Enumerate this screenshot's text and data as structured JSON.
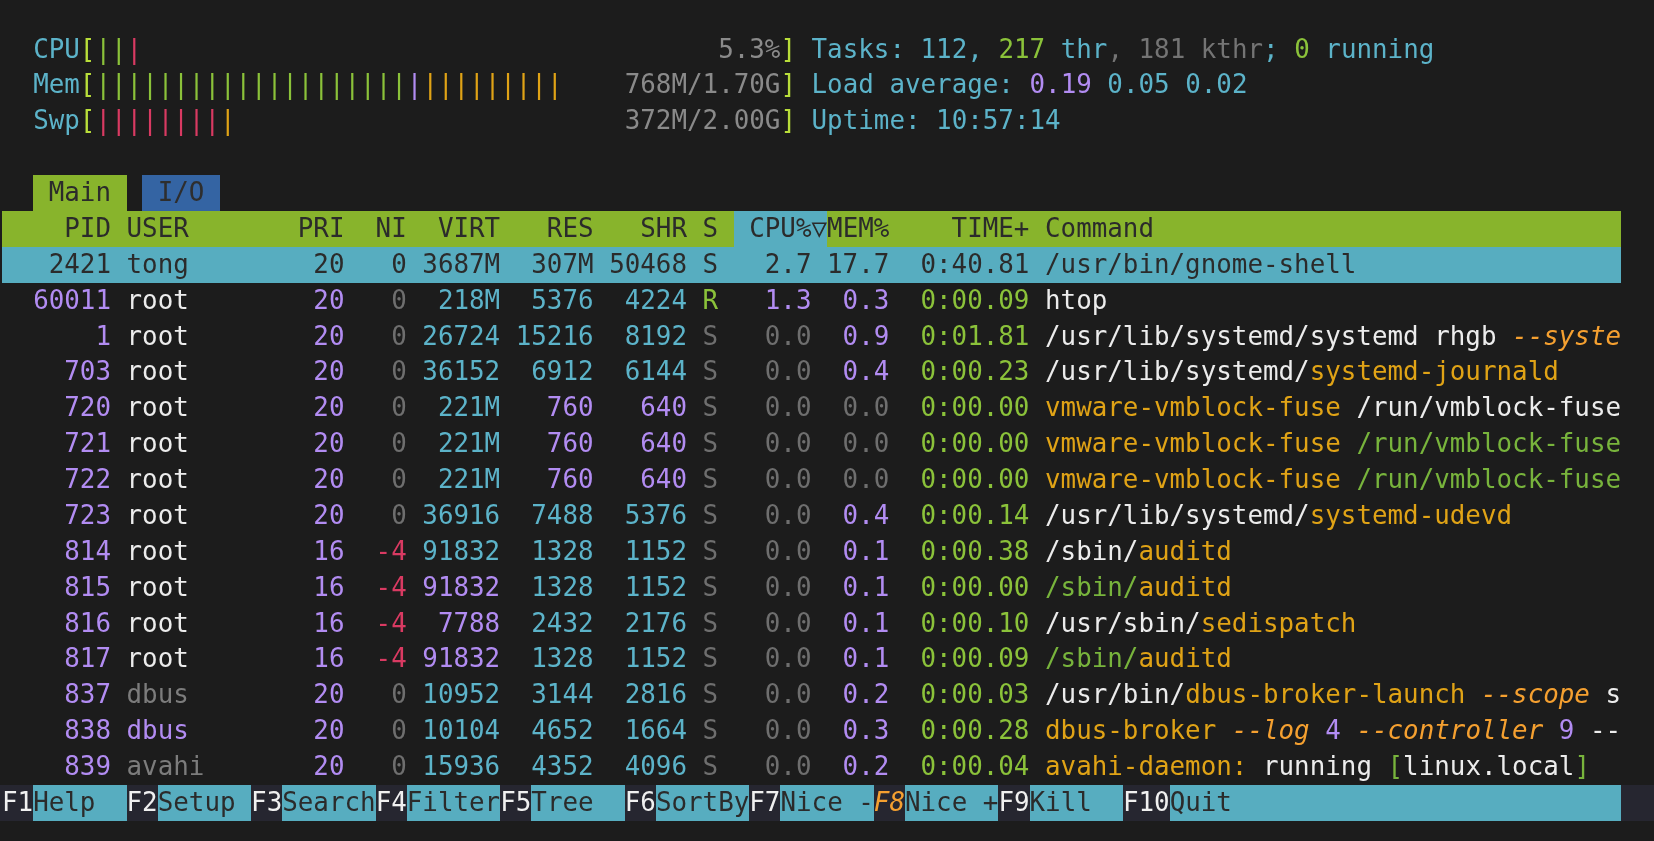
{
  "meters": [
    {
      "label": "CPU",
      "open": "[",
      "bars": [
        {
          "text": "||",
          "color": "#8bc23a"
        },
        {
          "text": "|",
          "color": "#d93a62"
        }
      ],
      "reading": "5.3%",
      "close": "]"
    },
    {
      "label": "Mem",
      "open": "[",
      "bars": [
        {
          "text": "||||||||||||||||||||",
          "color": "#8bc23a"
        },
        {
          "text": "|",
          "color": "#b28cf2"
        },
        {
          "text": "|||||||||",
          "color": "#e0a316"
        }
      ],
      "reading": "768M/1.70G",
      "close": "]"
    },
    {
      "label": "Swp",
      "open": "[",
      "bars": [
        {
          "text": "||||||||",
          "color": "#d93a62"
        },
        {
          "text": "|",
          "color": "#e0a316"
        }
      ],
      "reading": "372M/2.00G",
      "close": "]"
    }
  ],
  "summary": [
    [
      {
        "text": "Tasks: 112, ",
        "color": "#5cb3c9"
      },
      {
        "text": "217",
        "color": "#8bc23a"
      },
      {
        "text": " thr",
        "color": "#5cb3c9"
      },
      {
        "text": ", 181 kthr",
        "color": "#747474"
      },
      {
        "text": "; ",
        "color": "#5cb3c9"
      },
      {
        "text": "0",
        "color": "#8bc23a"
      },
      {
        "text": " running",
        "color": "#5cb3c9"
      }
    ],
    [
      {
        "text": "Load average: ",
        "color": "#5cb3c9"
      },
      {
        "text": "0.19",
        "color": "#b28cf2"
      },
      {
        "text": " 0.05 0.02",
        "color": "#5cb3c9"
      }
    ],
    [
      {
        "text": "Uptime: 10:57:14",
        "color": "#5cb3c9"
      }
    ]
  ],
  "tabs": [
    {
      "label": "Main",
      "selected": true
    },
    {
      "label": "I/O",
      "selected": false
    }
  ],
  "columns": [
    {
      "label": "PID",
      "selected": false
    },
    {
      "label": "USER",
      "selected": false
    },
    {
      "label": "PRI",
      "selected": false
    },
    {
      "label": "NI",
      "selected": false
    },
    {
      "label": "VIRT",
      "selected": false
    },
    {
      "label": "RES",
      "selected": false
    },
    {
      "label": "SHR",
      "selected": false
    },
    {
      "label": "S",
      "selected": false
    },
    {
      "label": "CPU%▽",
      "selected": true
    },
    {
      "label": "MEM%",
      "selected": false
    },
    {
      "label": "TIME+",
      "selected": false
    },
    {
      "label": "Command",
      "selected": false
    }
  ],
  "rows": [
    {
      "selected": true,
      "cells": [
        {
          "text": "2421"
        },
        {
          "text": "tong"
        },
        {
          "text": "20"
        },
        {
          "text": "0"
        },
        {
          "text": "3687M"
        },
        {
          "text": "307M"
        },
        {
          "text": "50468"
        },
        {
          "text": "S"
        },
        {
          "text": "2.7"
        },
        {
          "text": "17.7"
        },
        {
          "text": "0:40.81"
        }
      ],
      "command": [
        {
          "text": "/usr/bin/gnome-shell"
        }
      ]
    },
    {
      "selected": false,
      "cells": [
        {
          "text": "60011",
          "color": "#b28cf2"
        },
        {
          "text": "root",
          "color": "#ececec"
        },
        {
          "text": "20",
          "color": "#b28cf2"
        },
        {
          "text": "0",
          "color": "#6e6e6e"
        },
        {
          "text": "218M",
          "color": "#5cb3c9"
        },
        {
          "text": "5376",
          "color": "#5cb3c9"
        },
        {
          "text": "4224",
          "color": "#5cb3c9"
        },
        {
          "text": "R",
          "color": "#8bc23a"
        },
        {
          "text": "1.3",
          "color": "#b28cf2"
        },
        {
          "text": "0.3",
          "color": "#b28cf2"
        },
        {
          "text": "0:00.09",
          "color": "#8bc23a"
        }
      ],
      "command": [
        {
          "text": "htop",
          "color": "#ececec"
        }
      ]
    },
    {
      "selected": false,
      "cells": [
        {
          "text": "1",
          "color": "#b28cf2"
        },
        {
          "text": "root",
          "color": "#ececec"
        },
        {
          "text": "20",
          "color": "#b28cf2"
        },
        {
          "text": "0",
          "color": "#6e6e6e"
        },
        {
          "text": "26724",
          "color": "#5cb3c9"
        },
        {
          "text": "15216",
          "color": "#5cb3c9"
        },
        {
          "text": "8192",
          "color": "#5cb3c9"
        },
        {
          "text": "S",
          "color": "#6e6e6e"
        },
        {
          "text": "0.0",
          "color": "#6e6e6e"
        },
        {
          "text": "0.9",
          "color": "#b28cf2"
        },
        {
          "text": "0:01.81",
          "color": "#8bc23a"
        }
      ],
      "command": [
        {
          "text": "/usr/lib/systemd/systemd rhgb ",
          "color": "#ececec"
        },
        {
          "text": "--syste",
          "color": "#f5a030",
          "italic": true
        }
      ]
    },
    {
      "selected": false,
      "cells": [
        {
          "text": "703",
          "color": "#b28cf2"
        },
        {
          "text": "root",
          "color": "#ececec"
        },
        {
          "text": "20",
          "color": "#b28cf2"
        },
        {
          "text": "0",
          "color": "#6e6e6e"
        },
        {
          "text": "36152",
          "color": "#5cb3c9"
        },
        {
          "text": "6912",
          "color": "#5cb3c9"
        },
        {
          "text": "6144",
          "color": "#5cb3c9"
        },
        {
          "text": "S",
          "color": "#6e6e6e"
        },
        {
          "text": "0.0",
          "color": "#6e6e6e"
        },
        {
          "text": "0.4",
          "color": "#b28cf2"
        },
        {
          "text": "0:00.23",
          "color": "#8bc23a"
        }
      ],
      "command": [
        {
          "text": "/usr/lib/systemd/",
          "color": "#ececec"
        },
        {
          "text": "systemd-journald",
          "color": "#e0a316"
        }
      ]
    },
    {
      "selected": false,
      "cells": [
        {
          "text": "720",
          "color": "#b28cf2"
        },
        {
          "text": "root",
          "color": "#ececec"
        },
        {
          "text": "20",
          "color": "#b28cf2"
        },
        {
          "text": "0",
          "color": "#6e6e6e"
        },
        {
          "text": "221M",
          "color": "#5cb3c9"
        },
        {
          "text": "760",
          "color": "#b28cf2"
        },
        {
          "text": "640",
          "color": "#b28cf2"
        },
        {
          "text": "S",
          "color": "#6e6e6e"
        },
        {
          "text": "0.0",
          "color": "#6e6e6e"
        },
        {
          "text": "0.0",
          "color": "#6e6e6e"
        },
        {
          "text": "0:00.00",
          "color": "#8bc23a"
        }
      ],
      "command": [
        {
          "text": "vmware-vmblock-fuse",
          "color": "#e0a316"
        },
        {
          "text": " /run/vmblock-fuse",
          "color": "#ececec"
        }
      ]
    },
    {
      "selected": false,
      "cells": [
        {
          "text": "721",
          "color": "#b28cf2"
        },
        {
          "text": "root",
          "color": "#ececec"
        },
        {
          "text": "20",
          "color": "#b28cf2"
        },
        {
          "text": "0",
          "color": "#6e6e6e"
        },
        {
          "text": "221M",
          "color": "#5cb3c9"
        },
        {
          "text": "760",
          "color": "#b28cf2"
        },
        {
          "text": "640",
          "color": "#b28cf2"
        },
        {
          "text": "S",
          "color": "#6e6e6e"
        },
        {
          "text": "0.0",
          "color": "#6e6e6e"
        },
        {
          "text": "0.0",
          "color": "#6e6e6e"
        },
        {
          "text": "0:00.00",
          "color": "#8bc23a"
        }
      ],
      "command": [
        {
          "text": "vmware-vmblock-fuse",
          "color": "#e0a316"
        },
        {
          "text": " /run/vmblock-fuse",
          "color": "#78b43c"
        }
      ]
    },
    {
      "selected": false,
      "cells": [
        {
          "text": "722",
          "color": "#b28cf2"
        },
        {
          "text": "root",
          "color": "#ececec"
        },
        {
          "text": "20",
          "color": "#b28cf2"
        },
        {
          "text": "0",
          "color": "#6e6e6e"
        },
        {
          "text": "221M",
          "color": "#5cb3c9"
        },
        {
          "text": "760",
          "color": "#b28cf2"
        },
        {
          "text": "640",
          "color": "#b28cf2"
        },
        {
          "text": "S",
          "color": "#6e6e6e"
        },
        {
          "text": "0.0",
          "color": "#6e6e6e"
        },
        {
          "text": "0.0",
          "color": "#6e6e6e"
        },
        {
          "text": "0:00.00",
          "color": "#8bc23a"
        }
      ],
      "command": [
        {
          "text": "vmware-vmblock-fuse",
          "color": "#e0a316"
        },
        {
          "text": " /run/vmblock-fuse",
          "color": "#78b43c"
        }
      ]
    },
    {
      "selected": false,
      "cells": [
        {
          "text": "723",
          "color": "#b28cf2"
        },
        {
          "text": "root",
          "color": "#ececec"
        },
        {
          "text": "20",
          "color": "#b28cf2"
        },
        {
          "text": "0",
          "color": "#6e6e6e"
        },
        {
          "text": "36916",
          "color": "#5cb3c9"
        },
        {
          "text": "7488",
          "color": "#5cb3c9"
        },
        {
          "text": "5376",
          "color": "#5cb3c9"
        },
        {
          "text": "S",
          "color": "#6e6e6e"
        },
        {
          "text": "0.0",
          "color": "#6e6e6e"
        },
        {
          "text": "0.4",
          "color": "#b28cf2"
        },
        {
          "text": "0:00.14",
          "color": "#8bc23a"
        }
      ],
      "command": [
        {
          "text": "/usr/lib/systemd/",
          "color": "#ececec"
        },
        {
          "text": "systemd-udevd",
          "color": "#e0a316"
        }
      ]
    },
    {
      "selected": false,
      "cells": [
        {
          "text": "814",
          "color": "#b28cf2"
        },
        {
          "text": "root",
          "color": "#ececec"
        },
        {
          "text": "16",
          "color": "#b28cf2"
        },
        {
          "text": "-4",
          "color": "#d93a62"
        },
        {
          "text": "91832",
          "color": "#5cb3c9"
        },
        {
          "text": "1328",
          "color": "#5cb3c9"
        },
        {
          "text": "1152",
          "color": "#5cb3c9"
        },
        {
          "text": "S",
          "color": "#6e6e6e"
        },
        {
          "text": "0.0",
          "color": "#6e6e6e"
        },
        {
          "text": "0.1",
          "color": "#b28cf2"
        },
        {
          "text": "0:00.38",
          "color": "#8bc23a"
        }
      ],
      "command": [
        {
          "text": "/sbin/",
          "color": "#ececec"
        },
        {
          "text": "auditd",
          "color": "#e0a316"
        }
      ]
    },
    {
      "selected": false,
      "cells": [
        {
          "text": "815",
          "color": "#b28cf2"
        },
        {
          "text": "root",
          "color": "#ececec"
        },
        {
          "text": "16",
          "color": "#b28cf2"
        },
        {
          "text": "-4",
          "color": "#d93a62"
        },
        {
          "text": "91832",
          "color": "#b28cf2"
        },
        {
          "text": "1328",
          "color": "#5cb3c9"
        },
        {
          "text": "1152",
          "color": "#5cb3c9"
        },
        {
          "text": "S",
          "color": "#6e6e6e"
        },
        {
          "text": "0.0",
          "color": "#6e6e6e"
        },
        {
          "text": "0.1",
          "color": "#b28cf2"
        },
        {
          "text": "0:00.00",
          "color": "#8bc23a"
        }
      ],
      "command": [
        {
          "text": "/sbin/",
          "color": "#78b43c"
        },
        {
          "text": "auditd",
          "color": "#e0a316"
        }
      ]
    },
    {
      "selected": false,
      "cells": [
        {
          "text": "816",
          "color": "#b28cf2"
        },
        {
          "text": "root",
          "color": "#ececec"
        },
        {
          "text": "16",
          "color": "#b28cf2"
        },
        {
          "text": "-4",
          "color": "#d93a62"
        },
        {
          "text": "7788",
          "color": "#b28cf2"
        },
        {
          "text": "2432",
          "color": "#5cb3c9"
        },
        {
          "text": "2176",
          "color": "#5cb3c9"
        },
        {
          "text": "S",
          "color": "#6e6e6e"
        },
        {
          "text": "0.0",
          "color": "#6e6e6e"
        },
        {
          "text": "0.1",
          "color": "#b28cf2"
        },
        {
          "text": "0:00.10",
          "color": "#8bc23a"
        }
      ],
      "command": [
        {
          "text": "/usr/sbin/",
          "color": "#ececec"
        },
        {
          "text": "sedispatch",
          "color": "#e0a316"
        }
      ]
    },
    {
      "selected": false,
      "cells": [
        {
          "text": "817",
          "color": "#b28cf2"
        },
        {
          "text": "root",
          "color": "#ececec"
        },
        {
          "text": "16",
          "color": "#b28cf2"
        },
        {
          "text": "-4",
          "color": "#d93a62"
        },
        {
          "text": "91832",
          "color": "#b28cf2"
        },
        {
          "text": "1328",
          "color": "#5cb3c9"
        },
        {
          "text": "1152",
          "color": "#5cb3c9"
        },
        {
          "text": "S",
          "color": "#6e6e6e"
        },
        {
          "text": "0.0",
          "color": "#6e6e6e"
        },
        {
          "text": "0.1",
          "color": "#b28cf2"
        },
        {
          "text": "0:00.09",
          "color": "#8bc23a"
        }
      ],
      "command": [
        {
          "text": "/sbin/",
          "color": "#78b43c"
        },
        {
          "text": "auditd",
          "color": "#e0a316"
        }
      ]
    },
    {
      "selected": false,
      "cells": [
        {
          "text": "837",
          "color": "#b28cf2"
        },
        {
          "text": "dbus",
          "color": "#7c7c7c"
        },
        {
          "text": "20",
          "color": "#b28cf2"
        },
        {
          "text": "0",
          "color": "#6e6e6e"
        },
        {
          "text": "10952",
          "color": "#5cb3c9"
        },
        {
          "text": "3144",
          "color": "#5cb3c9"
        },
        {
          "text": "2816",
          "color": "#5cb3c9"
        },
        {
          "text": "S",
          "color": "#6e6e6e"
        },
        {
          "text": "0.0",
          "color": "#6e6e6e"
        },
        {
          "text": "0.2",
          "color": "#b28cf2"
        },
        {
          "text": "0:00.03",
          "color": "#8bc23a"
        }
      ],
      "command": [
        {
          "text": "/usr/bin/",
          "color": "#ececec"
        },
        {
          "text": "dbus-broker-launch",
          "color": "#e0a316"
        },
        {
          "text": " --scope",
          "color": "#f5a030",
          "italic": true
        },
        {
          "text": " s",
          "color": "#ececec"
        }
      ]
    },
    {
      "selected": false,
      "cells": [
        {
          "text": "838",
          "color": "#b28cf2"
        },
        {
          "text": "dbus",
          "color": "#b28cf2"
        },
        {
          "text": "20",
          "color": "#b28cf2"
        },
        {
          "text": "0",
          "color": "#6e6e6e"
        },
        {
          "text": "10104",
          "color": "#5cb3c9"
        },
        {
          "text": "4652",
          "color": "#5cb3c9"
        },
        {
          "text": "1664",
          "color": "#5cb3c9"
        },
        {
          "text": "S",
          "color": "#6e6e6e"
        },
        {
          "text": "0.0",
          "color": "#6e6e6e"
        },
        {
          "text": "0.3",
          "color": "#b28cf2"
        },
        {
          "text": "0:00.28",
          "color": "#8bc23a"
        }
      ],
      "command": [
        {
          "text": "dbus-broker",
          "color": "#e0a316"
        },
        {
          "text": " --log",
          "color": "#f5a030",
          "italic": true
        },
        {
          "text": " 4",
          "color": "#b28cf2"
        },
        {
          "text": " --controller",
          "color": "#f5a030",
          "italic": true
        },
        {
          "text": " 9",
          "color": "#b28cf2"
        },
        {
          "text": " --",
          "color": "#ececec"
        }
      ]
    },
    {
      "selected": false,
      "cells": [
        {
          "text": "839",
          "color": "#b28cf2"
        },
        {
          "text": "avahi",
          "color": "#7c7c7c"
        },
        {
          "text": "20",
          "color": "#b28cf2"
        },
        {
          "text": "0",
          "color": "#6e6e6e"
        },
        {
          "text": "15936",
          "color": "#5cb3c9"
        },
        {
          "text": "4352",
          "color": "#5cb3c9"
        },
        {
          "text": "4096",
          "color": "#5cb3c9"
        },
        {
          "text": "S",
          "color": "#6e6e6e"
        },
        {
          "text": "0.0",
          "color": "#6e6e6e"
        },
        {
          "text": "0.2",
          "color": "#b28cf2"
        },
        {
          "text": "0:00.04",
          "color": "#8bc23a"
        }
      ],
      "command": [
        {
          "text": "avahi-daemon:",
          "color": "#e0a316"
        },
        {
          "text": " running ",
          "color": "#ececec"
        },
        {
          "text": "[",
          "color": "#78b43c"
        },
        {
          "text": "linux.local",
          "color": "#ececec"
        },
        {
          "text": "]",
          "color": "#78b43c"
        }
      ]
    }
  ],
  "function_keys": [
    {
      "key": "F1",
      "label": "Help",
      "emphasis": false
    },
    {
      "key": "F2",
      "label": "Setup",
      "emphasis": false
    },
    {
      "key": "F3",
      "label": "Search",
      "emphasis": false
    },
    {
      "key": "F4",
      "label": "Filter",
      "emphasis": false
    },
    {
      "key": "F5",
      "label": "Tree",
      "emphasis": false
    },
    {
      "key": "F6",
      "label": "SortBy",
      "emphasis": false
    },
    {
      "key": "F7",
      "label": "Nice -",
      "emphasis": false
    },
    {
      "key": "F8",
      "label": "Nice +",
      "emphasis": true
    },
    {
      "key": "F9",
      "label": "Kill",
      "emphasis": false
    },
    {
      "key": "F10",
      "label": "Quit",
      "emphasis": false
    }
  ]
}
